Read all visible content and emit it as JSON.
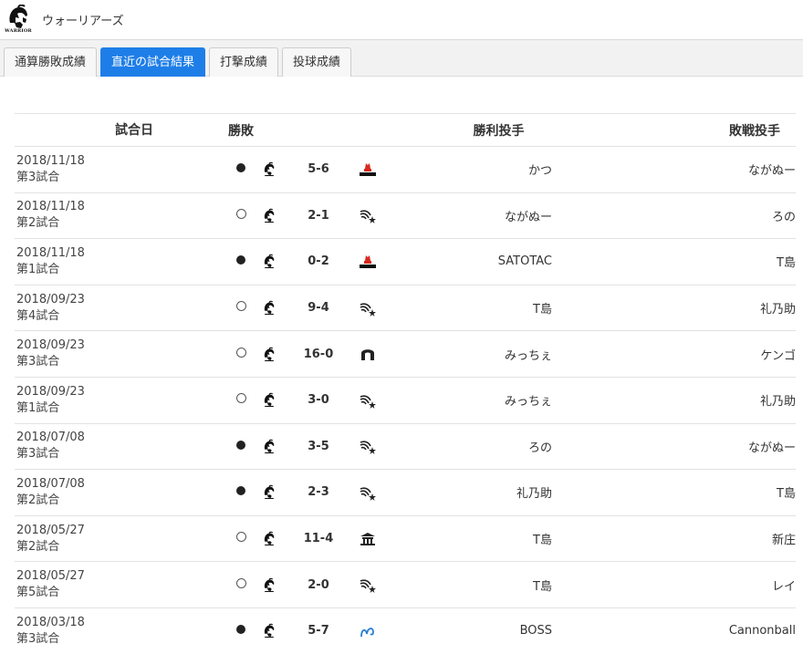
{
  "header": {
    "team_name": "ウォーリアーズ",
    "logo_text": "WARRIOR"
  },
  "tabs": [
    {
      "label": "通算勝敗成績",
      "active": false
    },
    {
      "label": "直近の試合結果",
      "active": true
    },
    {
      "label": "打撃成績",
      "active": false
    },
    {
      "label": "投球成績",
      "active": false
    }
  ],
  "table": {
    "headers": {
      "date": "試合日",
      "result": "勝敗",
      "win_pitcher": "勝利投手",
      "lose_pitcher": "敗戦投手"
    },
    "rows": [
      {
        "date": "2018/11/18",
        "game": "第3試合",
        "result": "loss",
        "score": "5-6",
        "opponent_icon": "red-tower-logo-icon",
        "win_pitcher": "かつ",
        "lose_pitcher": "ながぬー"
      },
      {
        "date": "2018/11/18",
        "game": "第2試合",
        "result": "win",
        "score": "2-1",
        "opponent_icon": "star-swoosh-logo-icon",
        "win_pitcher": "ながぬー",
        "lose_pitcher": "ろの"
      },
      {
        "date": "2018/11/18",
        "game": "第1試合",
        "result": "loss",
        "score": "0-2",
        "opponent_icon": "red-tower-logo-icon",
        "win_pitcher": "SATOTAC",
        "lose_pitcher": "T島"
      },
      {
        "date": "2018/09/23",
        "game": "第4試合",
        "result": "win",
        "score": "9-4",
        "opponent_icon": "star-swoosh-logo-icon",
        "win_pitcher": "T島",
        "lose_pitcher": "礼乃助"
      },
      {
        "date": "2018/09/23",
        "game": "第3試合",
        "result": "win",
        "score": "16-0",
        "opponent_icon": "arch-logo-icon",
        "win_pitcher": "みっちぇ",
        "lose_pitcher": "ケンゴ"
      },
      {
        "date": "2018/09/23",
        "game": "第1試合",
        "result": "win",
        "score": "3-0",
        "opponent_icon": "star-swoosh-logo-icon",
        "win_pitcher": "みっちぇ",
        "lose_pitcher": "礼乃助"
      },
      {
        "date": "2018/07/08",
        "game": "第3試合",
        "result": "loss",
        "score": "3-5",
        "opponent_icon": "star-swoosh-logo-icon",
        "win_pitcher": "ろの",
        "lose_pitcher": "ながぬー"
      },
      {
        "date": "2018/07/08",
        "game": "第2試合",
        "result": "loss",
        "score": "2-3",
        "opponent_icon": "star-swoosh-logo-icon",
        "win_pitcher": "礼乃助",
        "lose_pitcher": "T島"
      },
      {
        "date": "2018/05/27",
        "game": "第2試合",
        "result": "win",
        "score": "11-4",
        "opponent_icon": "temple-logo-icon",
        "win_pitcher": "T島",
        "lose_pitcher": "新庄"
      },
      {
        "date": "2018/05/27",
        "game": "第5試合",
        "result": "win",
        "score": "2-0",
        "opponent_icon": "star-swoosh-logo-icon",
        "win_pitcher": "T島",
        "lose_pitcher": "レイ"
      },
      {
        "date": "2018/03/18",
        "game": "第3試合",
        "result": "loss",
        "score": "5-7",
        "opponent_icon": "blue-wave-logo-icon",
        "win_pitcher": "BOSS",
        "lose_pitcher": "Cannonball"
      }
    ]
  },
  "colors": {
    "active_tab": "#1e7ee8",
    "tower_red": "#d8281e",
    "wave_blue": "#2a7fd0"
  }
}
